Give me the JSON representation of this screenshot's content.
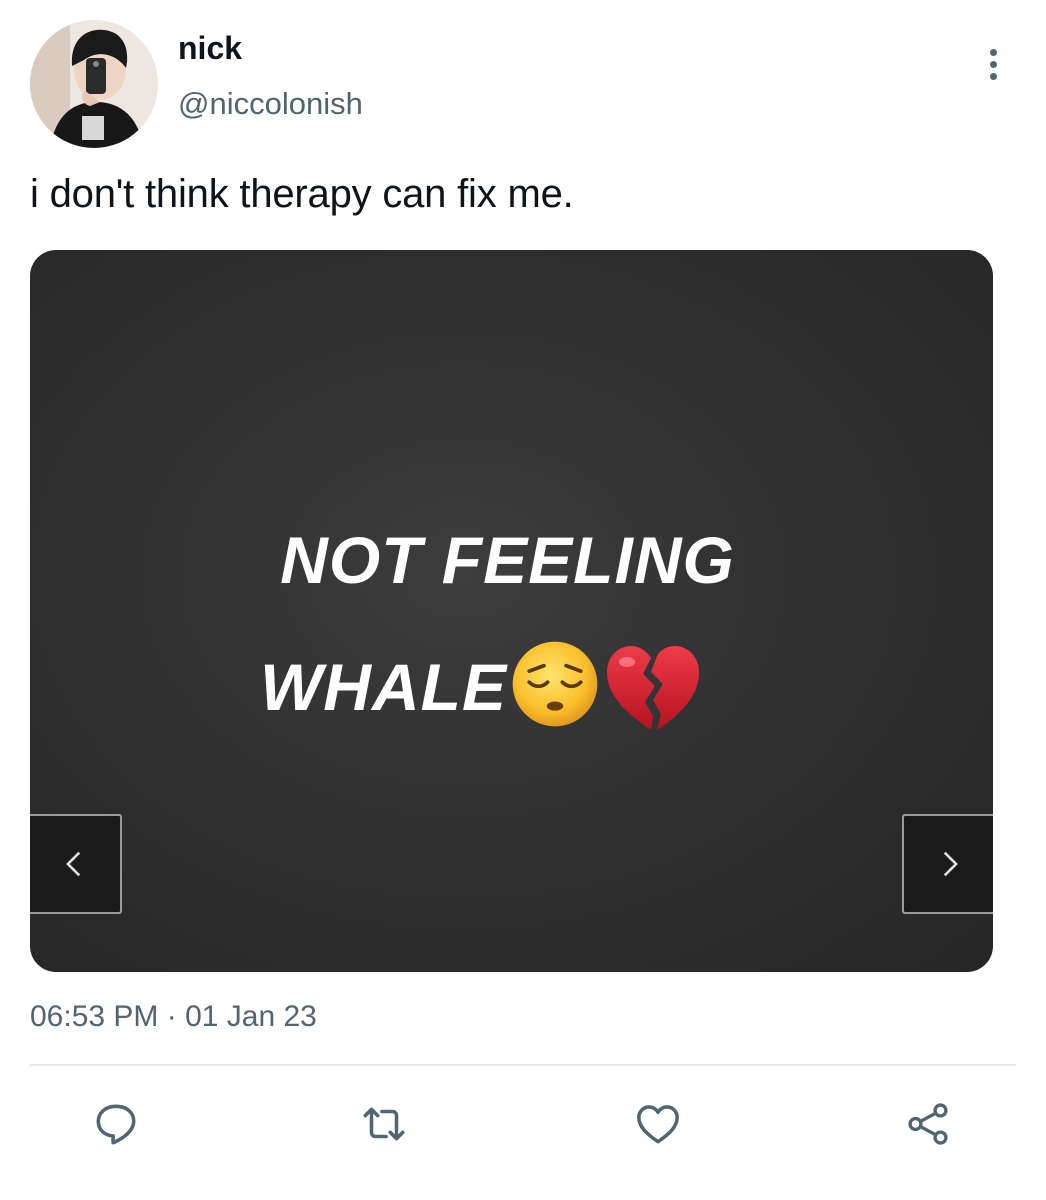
{
  "user": {
    "display_name": "nick",
    "handle": "@niccolonish",
    "avatar_icon": "profile-photo"
  },
  "tweet": {
    "text": "i don't think therapy can fix me.",
    "timestamp": "06:53 PM · 01 Jan 23"
  },
  "media": {
    "line1": "NOT FEELING",
    "line2": "WHALE",
    "emojis": [
      "pensive-face-icon",
      "broken-heart-icon"
    ]
  },
  "actions": {
    "icons": [
      "reply-icon",
      "retweet-icon",
      "like-icon",
      "share-icon"
    ]
  },
  "colors": {
    "text": "#0f1419",
    "secondary": "#536471",
    "divider": "#e7e9ea",
    "media_bg": "#2e2e2e"
  }
}
